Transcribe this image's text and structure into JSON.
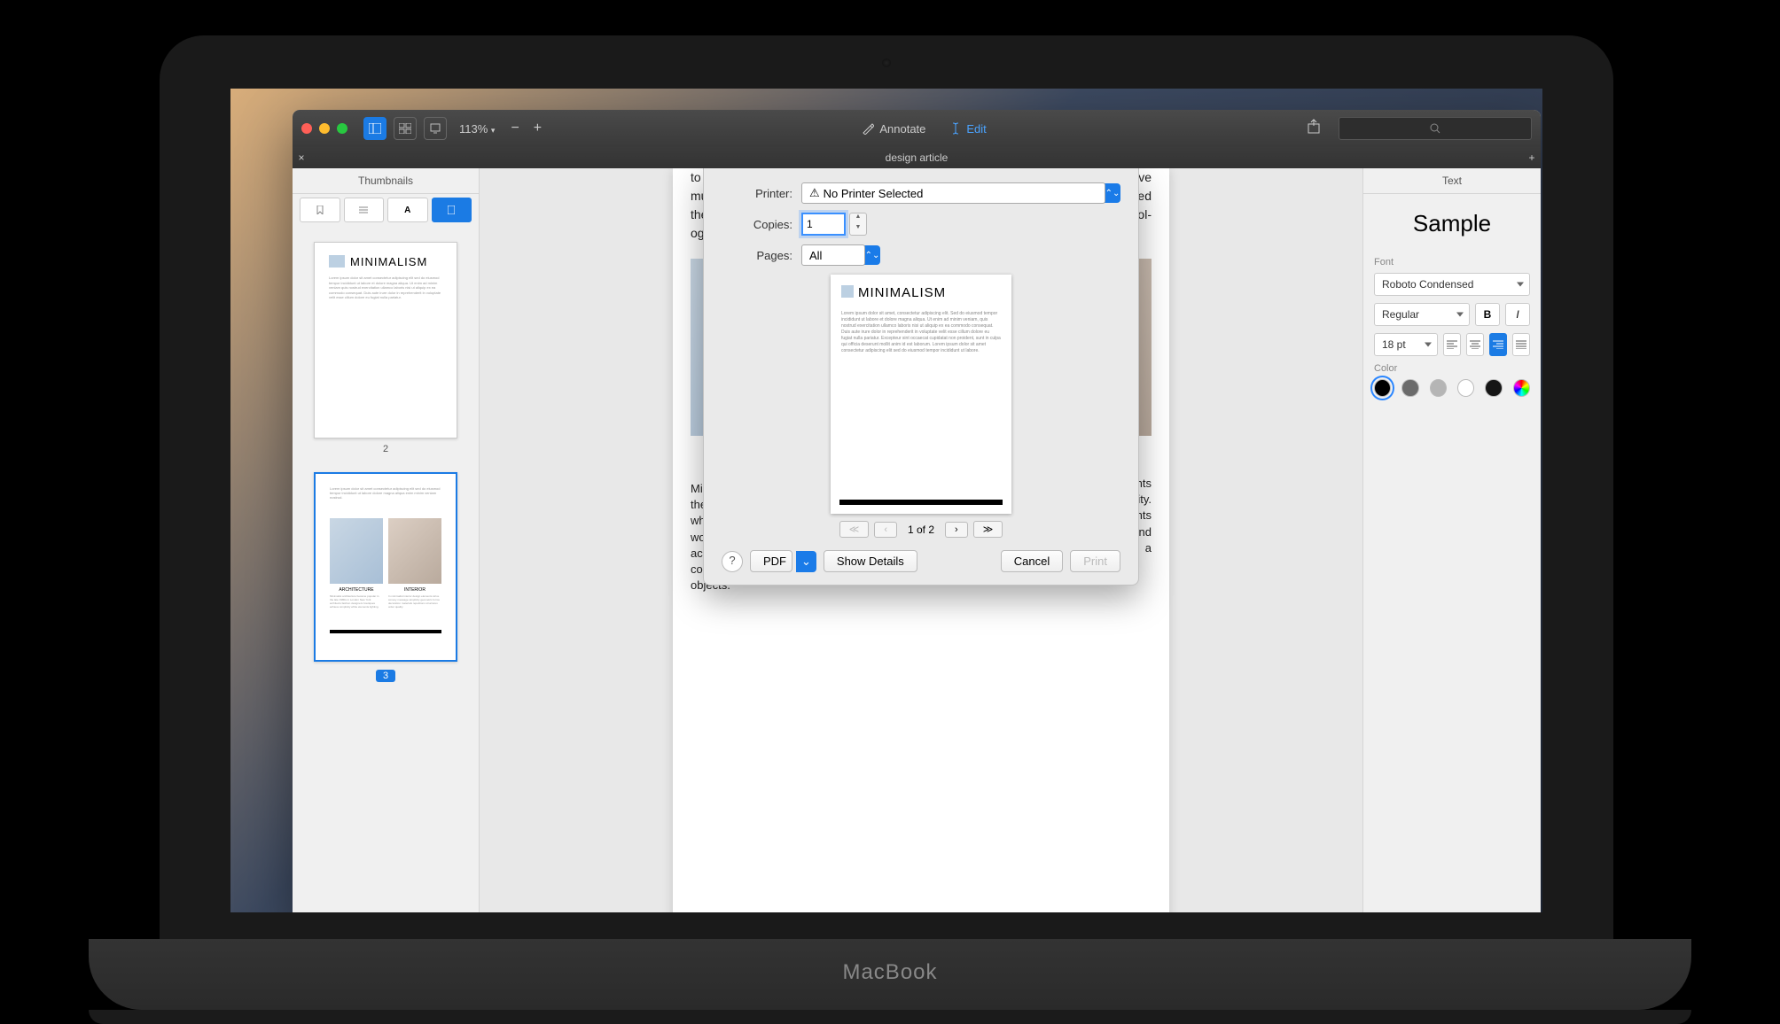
{
  "toolbar": {
    "zoom": "113%",
    "annotate_label": "Annotate",
    "edit_label": "Edit"
  },
  "tab": {
    "title": "design article"
  },
  "left_panel": {
    "title": "Thumbnails",
    "thumbs": [
      {
        "num": "2",
        "title": "MINIMALISM"
      },
      {
        "num": "3"
      }
    ]
  },
  "document": {
    "top_fragment": "to crea... multiple... the eng... ogy anc...  ...to serve ...adopted ...echnol-",
    "col1": {
      "heading": "ARCHITECTURE",
      "body": "Minimalist architecture became popular in the late 1980s in London and New York, where architects and fashion designers worked together in the boutiques to achieve simplicity, using white elements, cold lighting, large space with minimum objects."
    },
    "col2": {
      "heading": "INTERIOR",
      "body": "In minimalist interior, design elements strive to convey the message of simplicity. The basic geometric forms, elements without decoration, simple materials and the repetitions of structures represent a sense of order and essential quality."
    }
  },
  "print_dialog": {
    "printer_label": "Printer:",
    "printer_value": "No Printer Selected",
    "copies_label": "Copies:",
    "copies_value": "1",
    "pages_label": "Pages:",
    "pages_value": "All",
    "preview_title": "MINIMALISM",
    "page_indicator": "1 of 2",
    "pdf_label": "PDF",
    "show_details": "Show Details",
    "cancel": "Cancel",
    "print": "Print"
  },
  "right_panel": {
    "title": "Text",
    "sample": "Sample",
    "font_label": "Font",
    "font_family": "Roboto Condensed",
    "font_weight": "Regular",
    "font_size": "18 pt",
    "color_label": "Color",
    "colors": [
      "#000000",
      "#6b6b6b",
      "#b5b5b5",
      "#ffffff",
      "#151515",
      "#e06ab4"
    ]
  },
  "laptop_brand": "MacBook"
}
